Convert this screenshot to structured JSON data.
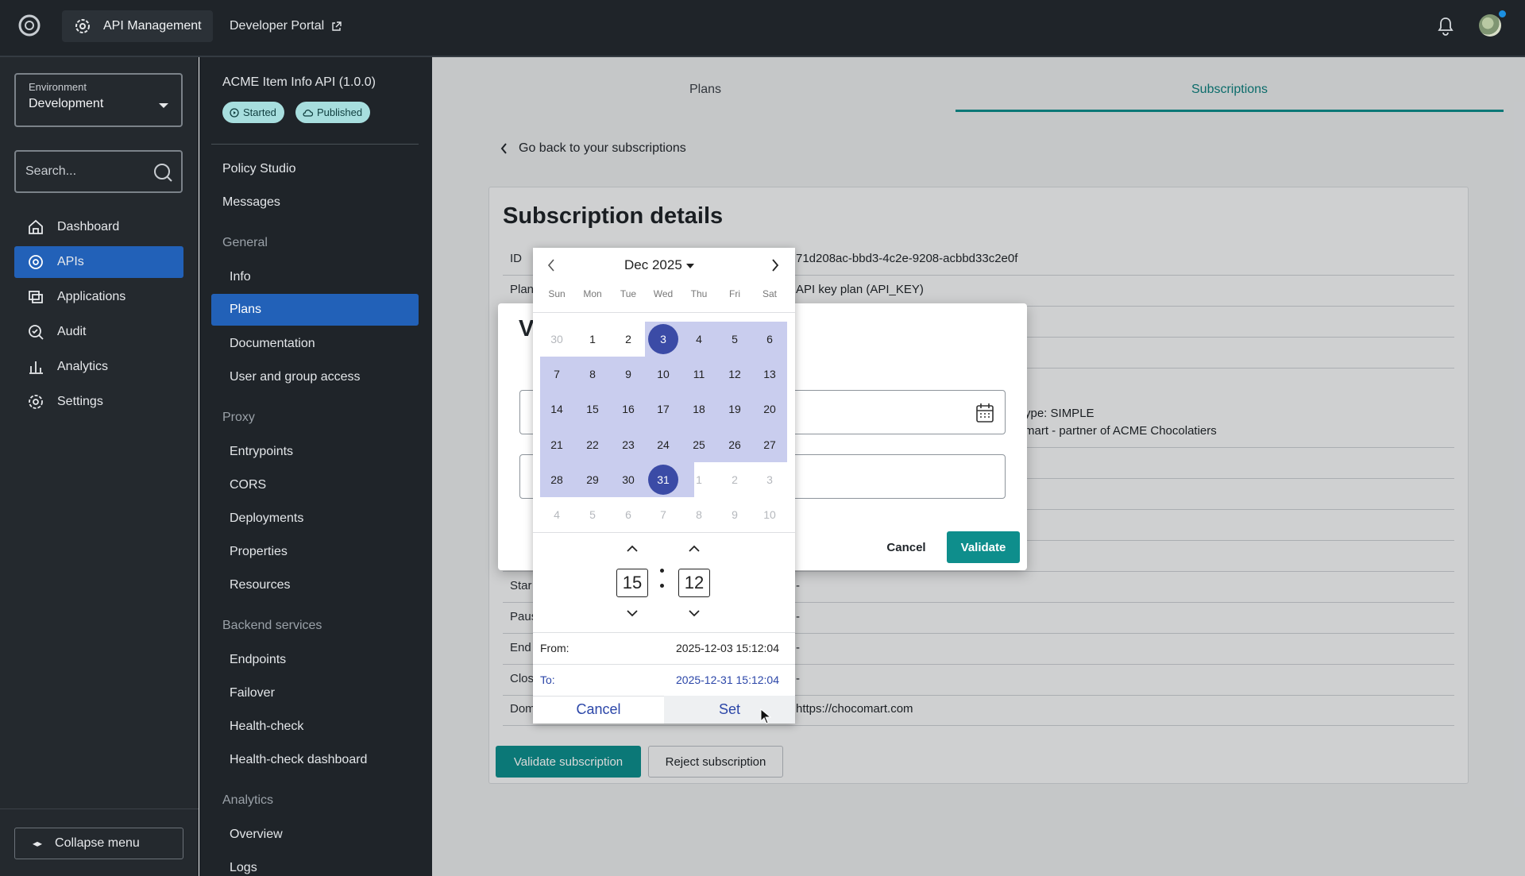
{
  "topbar": {
    "app_name": "API Management",
    "dev_portal": "Developer Portal"
  },
  "sidebar": {
    "env_label": "Environment",
    "env_value": "Development",
    "search_placeholder": "Search...",
    "items": [
      {
        "label": "Dashboard",
        "icon": "home-icon"
      },
      {
        "label": "APIs",
        "icon": "apis-icon"
      },
      {
        "label": "Applications",
        "icon": "applications-icon"
      },
      {
        "label": "Audit",
        "icon": "audit-icon"
      },
      {
        "label": "Analytics",
        "icon": "analytics-icon"
      },
      {
        "label": "Settings",
        "icon": "gear-icon"
      }
    ],
    "collapse": "Collapse menu"
  },
  "api_menu": {
    "title": "ACME Item Info API (1.0.0)",
    "badges": [
      "Started",
      "Published"
    ],
    "top_items": [
      "Policy Studio",
      "Messages"
    ],
    "general": {
      "title": "General",
      "items": [
        "Info",
        "Plans",
        "Documentation",
        "User and group access"
      ]
    },
    "proxy": {
      "title": "Proxy",
      "items": [
        "Entrypoints",
        "CORS",
        "Deployments",
        "Properties",
        "Resources"
      ]
    },
    "backend": {
      "title": "Backend services",
      "items": [
        "Endpoints",
        "Failover",
        "Health-check",
        "Health-check dashboard"
      ]
    },
    "analytics": {
      "title": "Analytics",
      "items": [
        "Overview",
        "Logs"
      ]
    }
  },
  "main": {
    "tabs": [
      "Plans",
      "Subscriptions"
    ],
    "back": "Go back to your subscriptions",
    "title": "Subscription details",
    "rows": [
      {
        "label": "ID",
        "value": "71d208ac-bbd3-4c2e-9208-acbbd33c2e0f"
      },
      {
        "label": "Plan",
        "value": "API key plan (API_KEY)"
      },
      {
        "label": "",
        "value": ""
      },
      {
        "label": "",
        "value": ""
      },
      {
        "label": "",
        "value": "ype: SIMPLE"
      },
      {
        "label": "",
        "value": "mart - partner of ACME Chocolatiers"
      },
      {
        "label": "",
        "value": ""
      },
      {
        "label": "",
        "value": ""
      },
      {
        "label": "",
        "value": ""
      },
      {
        "label": "Star",
        "value": "-"
      },
      {
        "label": "Paus",
        "value": "-"
      },
      {
        "label": "End",
        "value": "-"
      },
      {
        "label": "Clos",
        "value": "-"
      },
      {
        "label": "Dom",
        "value": "https://chocomart.com"
      }
    ],
    "validate_btn": "Validate subscription",
    "reject_btn": "Reject subscription"
  },
  "dialog": {
    "title_fragment": "V",
    "cancel": "Cancel",
    "validate": "Validate"
  },
  "picker": {
    "month": "Dec 2025",
    "weekdays": [
      "Sun",
      "Mon",
      "Tue",
      "Wed",
      "Thu",
      "Fri",
      "Sat"
    ],
    "weeks": [
      [
        "30",
        "1",
        "2",
        "3",
        "4",
        "5",
        "6"
      ],
      [
        "7",
        "8",
        "9",
        "10",
        "11",
        "12",
        "13"
      ],
      [
        "14",
        "15",
        "16",
        "17",
        "18",
        "19",
        "20"
      ],
      [
        "21",
        "22",
        "23",
        "24",
        "25",
        "26",
        "27"
      ],
      [
        "28",
        "29",
        "30",
        "31",
        "1",
        "2",
        "3"
      ],
      [
        "4",
        "5",
        "6",
        "7",
        "8",
        "9",
        "10"
      ]
    ],
    "hour": "15",
    "minute": "12",
    "from_label": "From:",
    "from_value": "2025-12-03 15:12:04",
    "to_label": "To:",
    "to_value": "2025-12-31 15:12:04",
    "cancel": "Cancel",
    "set": "Set"
  }
}
